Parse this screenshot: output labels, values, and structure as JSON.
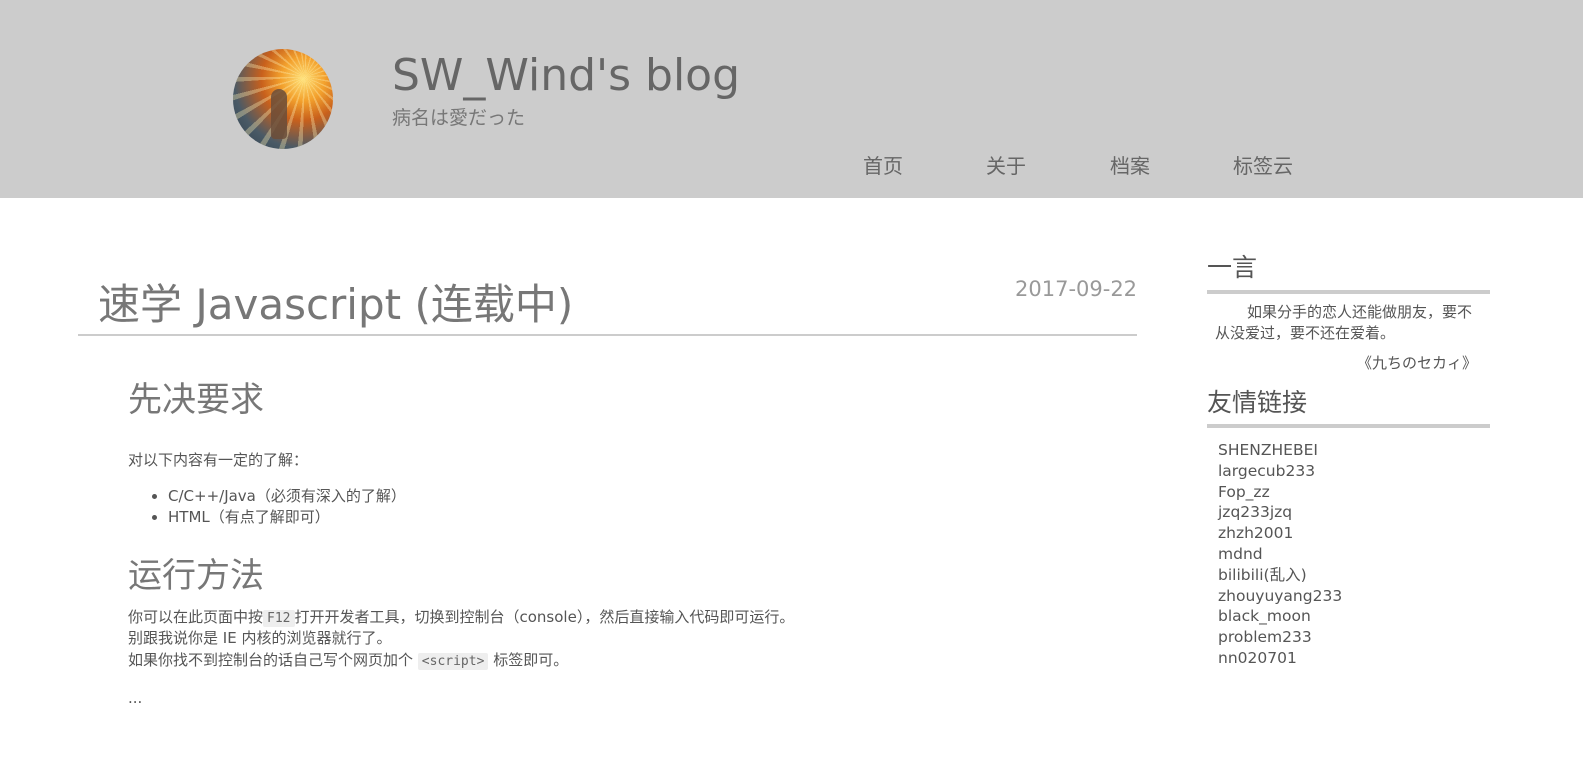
{
  "header": {
    "site_title": "SW_Wind's blog",
    "subtitle": "病名は愛だった",
    "nav": [
      "首页",
      "关于",
      "档案",
      "标签云"
    ]
  },
  "post": {
    "title": "速学 Javascript (连载中)",
    "date": "2017-09-22",
    "sections": [
      {
        "heading": "先决要求",
        "intro": "对以下内容有一定的了解：",
        "list": [
          "C/C++/Java（必须有深入的了解）",
          "HTML（有点了解即可）"
        ]
      },
      {
        "heading": "运行方法",
        "line1_pre": "你可以在此页面中按",
        "line1_code": "F12",
        "line1_post": "打开开发者工具，切换到控制台（console），然后直接输入代码即可运行。",
        "line2": "别跟我说你是 IE 内核的浏览器就行了。",
        "line3_pre": "如果你找不到控制台的话自己写个网页加个",
        "line3_code": "<script>",
        "line3_post": "标签即可。"
      }
    ],
    "ellipsis": "..."
  },
  "sidebar": {
    "hitokoto": {
      "title": "一言",
      "quote": "如果分手的恋人还能做朋友，要不从没爱过，要不还在爱着。",
      "source": "《九ちのセカィ》"
    },
    "friends": {
      "title": "友情链接",
      "links": [
        "SHENZHEBEI",
        "largecub233",
        "Fop_zz",
        "jzq233jzq",
        "zhzh2001",
        "mdnd",
        "bilibili(乱入)",
        "zhouyuyang233",
        "black_moon",
        "problem233",
        "nn020701"
      ]
    }
  },
  "colors": {
    "header_bg": "#cccccc",
    "text": "#666666",
    "rule": "#cccccc",
    "code_bg": "#eeeeee"
  }
}
